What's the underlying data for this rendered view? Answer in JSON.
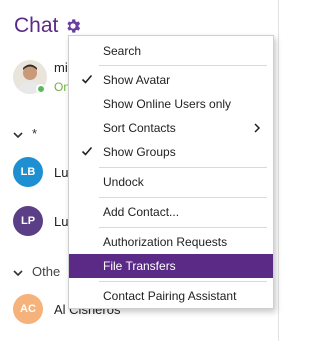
{
  "header": {
    "title": "Chat",
    "settings_icon": "gear-icon"
  },
  "me": {
    "name": "mi",
    "status": "On",
    "status_color": "#6db33f"
  },
  "groups": [
    {
      "label": "*"
    },
    {
      "label": "Othe"
    }
  ],
  "contacts": [
    {
      "initials": "LB",
      "name": "Lu",
      "color": "#1e8fd1"
    },
    {
      "initials": "LP",
      "name": "Lu",
      "color": "#5a3e86"
    },
    {
      "initials": "AC",
      "name": "Al Cisneros",
      "color": "#f5b27a"
    }
  ],
  "menu": {
    "items": [
      {
        "label": "Search",
        "checked": false
      },
      {
        "label": "Show Avatar",
        "checked": true
      },
      {
        "label": "Show Online Users only",
        "checked": false
      },
      {
        "label": "Sort Contacts",
        "checked": false,
        "submenu": true
      },
      {
        "label": "Show Groups",
        "checked": true
      },
      {
        "label": "Undock",
        "checked": false
      },
      {
        "label": "Add Contact...",
        "checked": false
      },
      {
        "label": "Authorization Requests",
        "checked": false
      },
      {
        "label": "File Transfers",
        "checked": false,
        "highlighted": true
      },
      {
        "label": "Contact Pairing Assistant",
        "checked": false
      }
    ]
  },
  "colors": {
    "accent": "#5b2a86",
    "highlight": "#5b2a86"
  }
}
